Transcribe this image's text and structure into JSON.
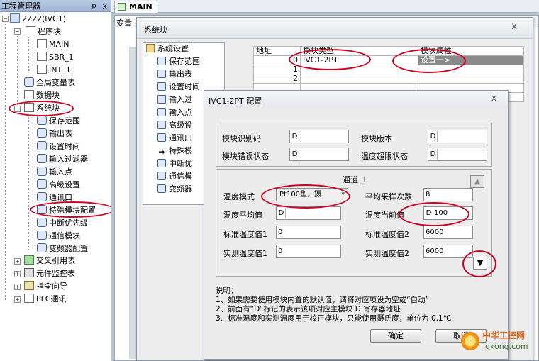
{
  "project_tree": {
    "title": "工程管理器",
    "pin": "ᵽ",
    "close": "x",
    "root": "2222(IVC1)",
    "program_block": "程序块",
    "programs": [
      "MAIN",
      "SBR_1",
      "INT_1"
    ],
    "global_vars": "全局变量表",
    "data_block": "数据块",
    "system_block": "系统块",
    "system_items": [
      "保存范围",
      "输出表",
      "设置时间",
      "输入过滤器",
      "输入点",
      "高级设置",
      "通讯口",
      "特殊模块配置",
      "中断优先级",
      "通信模块",
      "变频器配置"
    ],
    "cross_ref": "交叉引用表",
    "monitor": "元件监控表",
    "wizard": "指令向导",
    "plc_comm": "PLC通讯"
  },
  "main_window": {
    "tab": "MAIN",
    "var_label": "变量"
  },
  "system_block_dialog": {
    "title": "系统块",
    "close": "x",
    "tree_root": "系统设置",
    "tree_items": [
      "保存范围",
      "输出表",
      "设置时间",
      "输入过",
      "输入点",
      "高级设",
      "通讯口",
      "特殊模",
      "中断优",
      "通信模",
      "变频器"
    ],
    "table_headers": [
      "地址",
      "模块类型",
      "模块属性"
    ],
    "rows": [
      {
        "addr": "0",
        "type": "IVC1-2PT",
        "attr": "设置一>"
      },
      {
        "addr": "1",
        "type": "",
        "attr": ""
      },
      {
        "addr": "2",
        "type": "",
        "attr": ""
      },
      {
        "addr": "",
        "type": "",
        "attr": ""
      },
      {
        "addr": "",
        "type": "",
        "attr": ""
      }
    ]
  },
  "ivc_dialog": {
    "title": "IVC1-2PT 配置",
    "close": "x",
    "module_id_label": "模块识别码",
    "module_version_label": "模块版本",
    "module_error_label": "模块错误状态",
    "temp_over_label": "温度超限状态",
    "prefix": "D",
    "channel_title": "通道_1",
    "temp_mode_label": "温度模式",
    "temp_mode_value": "Pt100型，摄",
    "avg_samples_label": "平均采样次数",
    "avg_samples_value": "8",
    "temp_avg_label": "温度平均值",
    "temp_current_label": "温度当前值",
    "temp_current_value": "100",
    "std_temp1_label": "标准温度值1",
    "std_temp1_value": "0",
    "std_temp2_label": "标准温度值2",
    "std_temp2_value": "6000",
    "act_temp1_label": "实测温度值1",
    "act_temp1_value": "0",
    "act_temp2_label": "实测温度值2",
    "act_temp2_value": "6000",
    "notes_title": "说明：",
    "notes": [
      "1、如果需要使用模块内置的默认值，请将对应项设为空或“自动”",
      "2、前面有“D”标记的表示该项对应主模块 D 寄存器地址",
      "3、标准温度和实测温度用于校正模块，只能使用摄氏度，单位为 0.1℃"
    ],
    "ok": "确定",
    "cancel": "取消"
  },
  "watermark": {
    "line1": "中华工控网",
    "line2": "gkong.com"
  }
}
